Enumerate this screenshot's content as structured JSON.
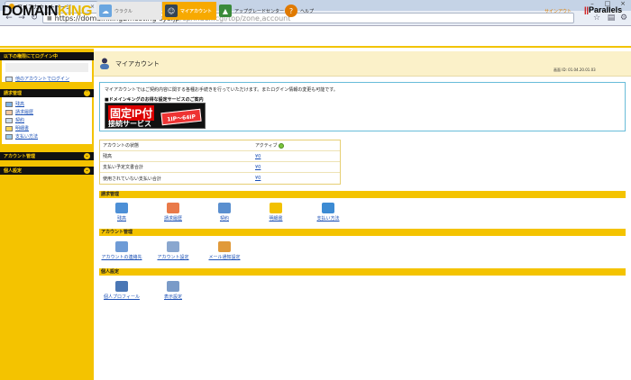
{
  "browser": {
    "tab_title": "マイアカウントページ",
    "tab_close": "×",
    "win_min": "–",
    "win_max": "□",
    "win_close": "×",
    "url_host": "https://domainking2.hosting-sys.jp",
    "url_path": "/cp/index.cgi/top/zone,account"
  },
  "header": {
    "logo_a": "DOMAIN",
    "logo_b": "KING",
    "nav": {
      "status": "ウラクル",
      "account": "マイアカウント",
      "upgrade": "アップグレードセンター",
      "help": "ヘルプ"
    },
    "signout": "サインアウト",
    "parallels": "Parallels"
  },
  "sidebar": {
    "login_header": "以下の権限にてログイン中",
    "login_link": "他のアカウントでログイン",
    "billing_header": "請求管理",
    "billing_items": [
      "残高",
      "請求履歴",
      "契約",
      "明細書",
      "支払い方法"
    ],
    "account_header": "アカウント管理",
    "personal_header": "個人設定"
  },
  "main": {
    "title": "マイアカウント",
    "screen_id": "画面 ID: 01.04.20.01.03",
    "intro": "マイアカウントではご契約内容に関する各種お手続きを行っていただけます。またログイン情報の変更も可能です。",
    "info_link": "■ドメインキングのお得な設定サービスのご案内",
    "banner_ip": "固定IP付",
    "banner_sub": "接続サービス",
    "banner_badge": "1IP～64IP",
    "status_rows": [
      {
        "label": "アカウントの状態",
        "value": "アクティブ"
      },
      {
        "label": "残高",
        "value": "¥0"
      },
      {
        "label": "支払い予定文書合計",
        "value": "¥0"
      },
      {
        "label": "使用されていない支払い合計",
        "value": "¥0"
      }
    ],
    "billing_section": "請求管理",
    "billing_tools": [
      "残高",
      "請求履歴",
      "契約",
      "明細書",
      "支払い方法"
    ],
    "account_section": "アカウント管理",
    "account_tools": [
      "アカウントの連絡先",
      "アカウント設定",
      "メール通知設定"
    ],
    "personal_section": "個人設定",
    "personal_tools": [
      "個人プロフィール",
      "表示設定"
    ]
  },
  "colors": {
    "accent": "#f4c300",
    "link": "#1a4fb5",
    "title_bg": "#fbf1c9"
  }
}
